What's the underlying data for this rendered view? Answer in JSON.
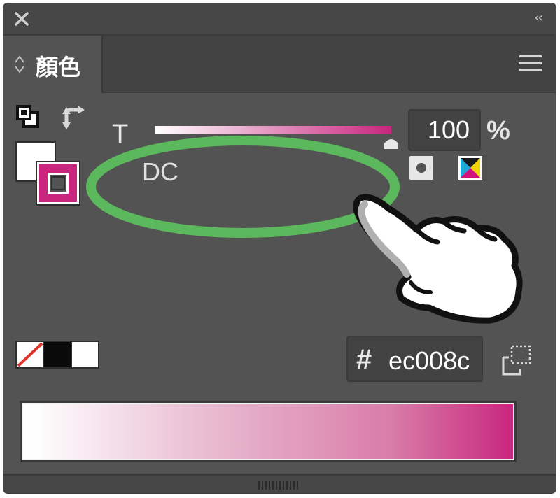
{
  "tab": {
    "label": "顏色"
  },
  "tint": {
    "label": "T",
    "value": "100",
    "unit": "%",
    "level_percent": 100,
    "color_start": "#ffffff",
    "color_end": "#c8267f"
  },
  "dc": {
    "label": "DC"
  },
  "hex": {
    "hash": "#",
    "value": "ec008c"
  },
  "stroke_color": "#c8267f",
  "fill_color": "#ffffff",
  "highlight_color": "#5cb85c",
  "icons": [
    "close-icon",
    "collapse-icon",
    "tab-arrows-icon",
    "menu-icon",
    "fill-stroke-icon",
    "swap-icon",
    "spot-color-icon",
    "cmyk-icon",
    "pointing-hand-icon",
    "add-swatch-icon"
  ]
}
